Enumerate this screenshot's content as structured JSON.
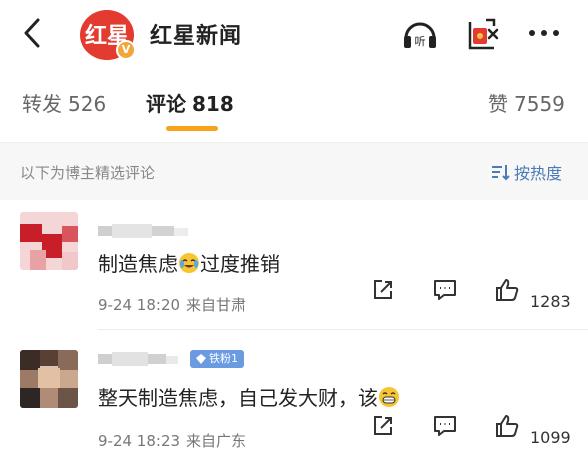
{
  "header": {
    "title": "红星新闻",
    "logo_text": "红星",
    "verified_badge": "V",
    "listen_label": "听"
  },
  "tabs": {
    "forward_label": "转发",
    "forward_count": "526",
    "comment_label": "评论",
    "comment_count": "818",
    "like_label": "赞",
    "like_count": "7559"
  },
  "section": {
    "label": "以下为博主精选评论",
    "sort_label": "按热度"
  },
  "comments": [
    {
      "text_a": "制造焦虑",
      "emoji": "cry-laugh-emoji",
      "text_b": "过度推销",
      "date": "9-24 18:20",
      "location": "来自甘肃",
      "likes": "1283"
    },
    {
      "badge": "铁粉1",
      "text_a": "整天制造焦虑，自己发大财，该",
      "emoji": "grin-emoji",
      "text_b": "",
      "date": "9-24 18:23",
      "location": "来自广东",
      "likes": "1099"
    }
  ],
  "colors": {
    "accent_orange": "#f7a31c",
    "brand_red": "#e33b2f",
    "sort_blue": "#4a7ab8",
    "badge_blue": "#6a9be0"
  }
}
